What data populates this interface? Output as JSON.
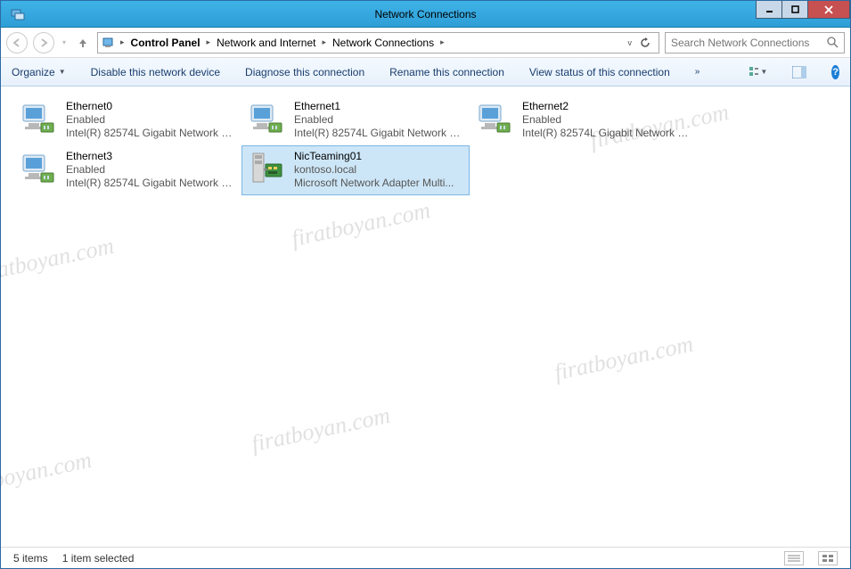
{
  "window": {
    "title": "Network Connections"
  },
  "breadcrumbs": {
    "root": "Control Panel",
    "mid": "Network and Internet",
    "leaf": "Network Connections"
  },
  "search": {
    "placeholder": "Search Network Connections"
  },
  "commands": {
    "organize": "Organize",
    "disable": "Disable this network device",
    "diagnose": "Diagnose this connection",
    "rename": "Rename this connection",
    "viewstatus": "View status of this connection"
  },
  "items": [
    {
      "name": "Ethernet0",
      "status": "Enabled",
      "device": "Intel(R) 82574L Gigabit Network C...",
      "selected": false,
      "type": "nic"
    },
    {
      "name": "Ethernet1",
      "status": "Enabled",
      "device": "Intel(R) 82574L Gigabit Network C...",
      "selected": false,
      "type": "nic"
    },
    {
      "name": "Ethernet2",
      "status": "Enabled",
      "device": "Intel(R) 82574L Gigabit Network C...",
      "selected": false,
      "type": "nic"
    },
    {
      "name": "Ethernet3",
      "status": "Enabled",
      "device": "Intel(R) 82574L Gigabit Network C...",
      "selected": false,
      "type": "nic"
    },
    {
      "name": "NicTeaming01",
      "status": "kontoso.local",
      "device": "Microsoft Network Adapter Multi...",
      "selected": true,
      "type": "team"
    }
  ],
  "status": {
    "count": "5 items",
    "selection": "1 item selected"
  },
  "watermark": "firatboyan.com"
}
